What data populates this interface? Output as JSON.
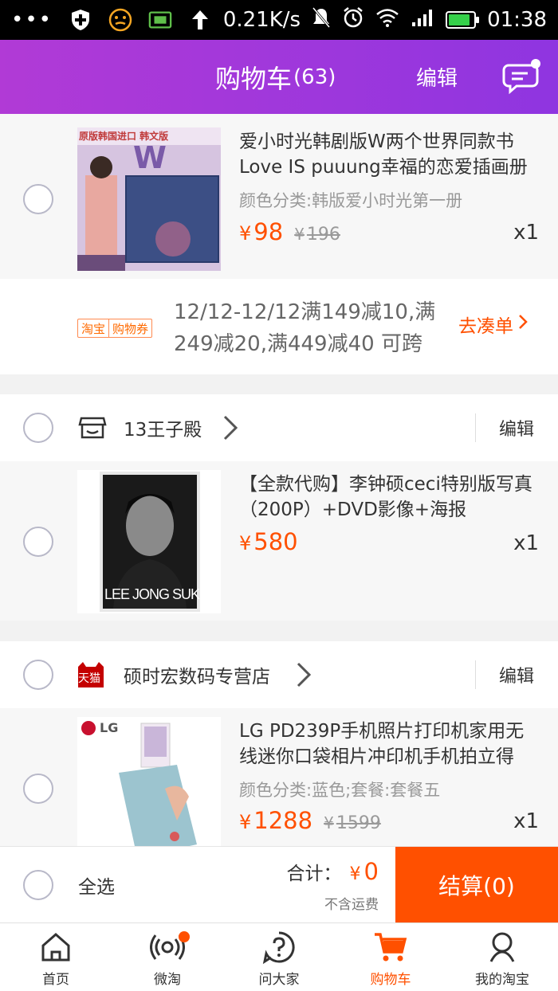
{
  "status_bar": {
    "speed": "0.21K/s",
    "time": "01:38",
    "battery_color": "#35d04a",
    "battery_level": 0.85,
    "icons": [
      "more-dots-icon",
      "shield-icon",
      "emoji-icon",
      "battery-saver-icon",
      "upload-arrow-icon",
      "mute-icon",
      "alarm-icon",
      "wifi-icon",
      "signal-icon",
      "battery-icon"
    ]
  },
  "header": {
    "title": "购物车",
    "count": "(63)",
    "edit_label": "编辑",
    "icon": "message-icon",
    "gradient_start": "#b13ad6",
    "gradient_end": "#8f35e0"
  },
  "items": [
    {
      "thumb_banner": "原版韩国进口 韩文版",
      "thumb_letter": "W",
      "title": "爱小时光韩剧版W两个世界同款书Love IS puuung幸福的恋爱插画册",
      "variant": "颜色分类:韩版爱小时光第一册",
      "currency": "¥",
      "price": "98",
      "old_price": "196",
      "qty": "x1"
    },
    {
      "thumb_caption": "LEE JONG SUK",
      "title": "【全款代购】李钟硕ceci特别版写真（200P）+DVD影像+海报",
      "currency": "¥",
      "price": "580",
      "qty": "x1"
    },
    {
      "thumb_brand": "LG",
      "title": "LG PD239P手机照片打印机家用无线迷你口袋相片冲印机手机拍立得",
      "variant": "颜色分类:蓝色;套餐:套餐五",
      "currency": "¥",
      "price": "1288",
      "old_price": "1599",
      "qty": "x1"
    }
  ],
  "coupon": {
    "badge_left": "淘宝",
    "badge_right": "购物券",
    "line1": "12/12-12/12满149减10,满",
    "line2": "249减20,满449减40 可跨",
    "go_label": "去凑单"
  },
  "shops": [
    {
      "name": "13王子殿",
      "edit_label": "编辑",
      "icon": "store-icon"
    },
    {
      "name": "硕时宏数码专营店",
      "edit_label": "编辑",
      "icon": "tmall-icon",
      "badge": "天猫"
    }
  ],
  "checkout": {
    "select_all": "全选",
    "total_label": "合计：",
    "currency": "¥",
    "total": "0",
    "shipping_note": "不含运费",
    "button_label": "结算(0)",
    "accent": "#ff5000"
  },
  "tabs": [
    {
      "label": "首页",
      "icon": "home-icon",
      "active": false
    },
    {
      "label": "微淘",
      "icon": "broadcast-icon",
      "active": false,
      "dot": true
    },
    {
      "label": "问大家",
      "icon": "question-icon",
      "active": false
    },
    {
      "label": "购物车",
      "icon": "cart-icon",
      "active": true
    },
    {
      "label": "我的淘宝",
      "icon": "profile-icon",
      "active": false
    }
  ]
}
